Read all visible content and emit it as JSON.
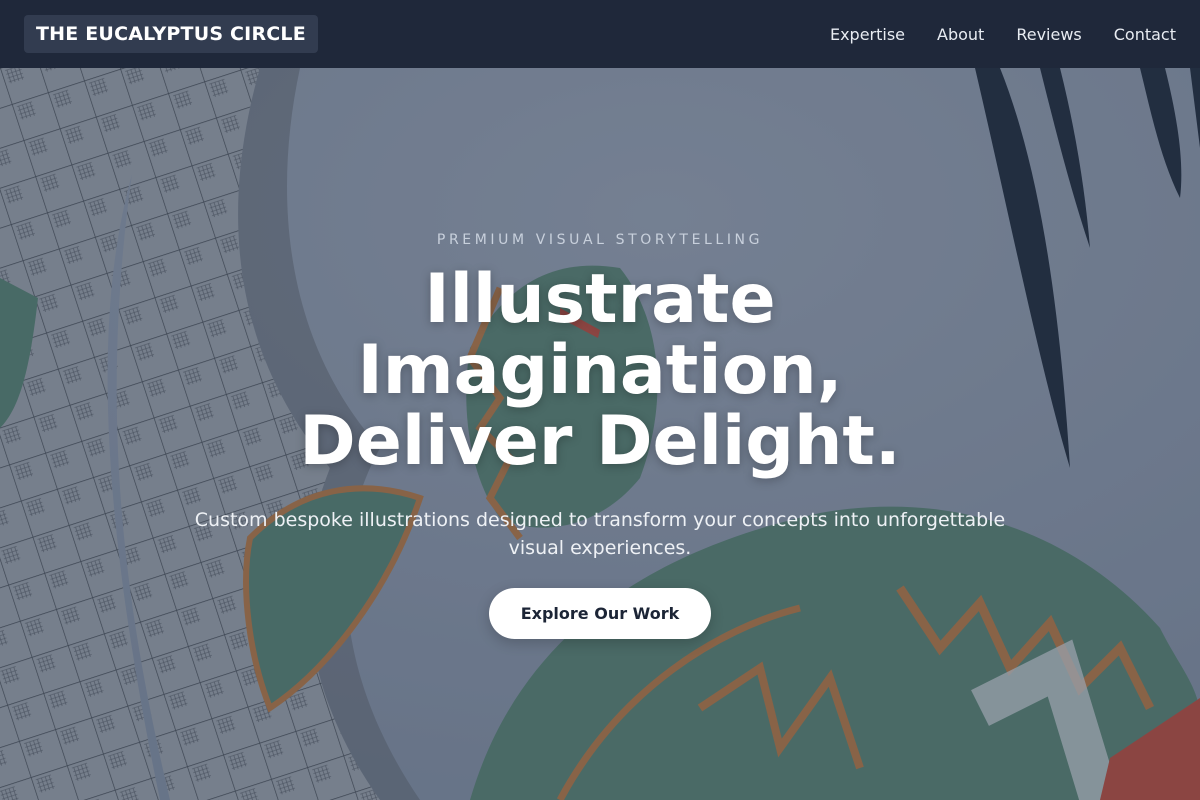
{
  "navbar": {
    "brand": "THE EUCALYPTUS CIRCLE",
    "links": [
      {
        "label": "Expertise"
      },
      {
        "label": "About"
      },
      {
        "label": "Reviews"
      },
      {
        "label": "Contact"
      }
    ]
  },
  "hero": {
    "eyebrow": "PREMIUM VISUAL STORYTELLING",
    "headline_lines": [
      "Illustrate",
      "Imagination,",
      "Deliver Delight."
    ],
    "subheadline": "Custom bespoke illustrations designed to transform your concepts into unforgettable visual experiences.",
    "cta_label": "Explore Our Work",
    "background_image": "illustration of leaves and a tiled dome"
  },
  "colors": {
    "navbar_bg": "#1f283a",
    "brand_bg": "#323c50",
    "overlay": "#283448",
    "cta_bg": "#ffffff",
    "cta_text": "#1c2536",
    "leaf_green": "#5d8b79",
    "accent_orange": "#c48048",
    "accent_red": "#c9503f"
  }
}
